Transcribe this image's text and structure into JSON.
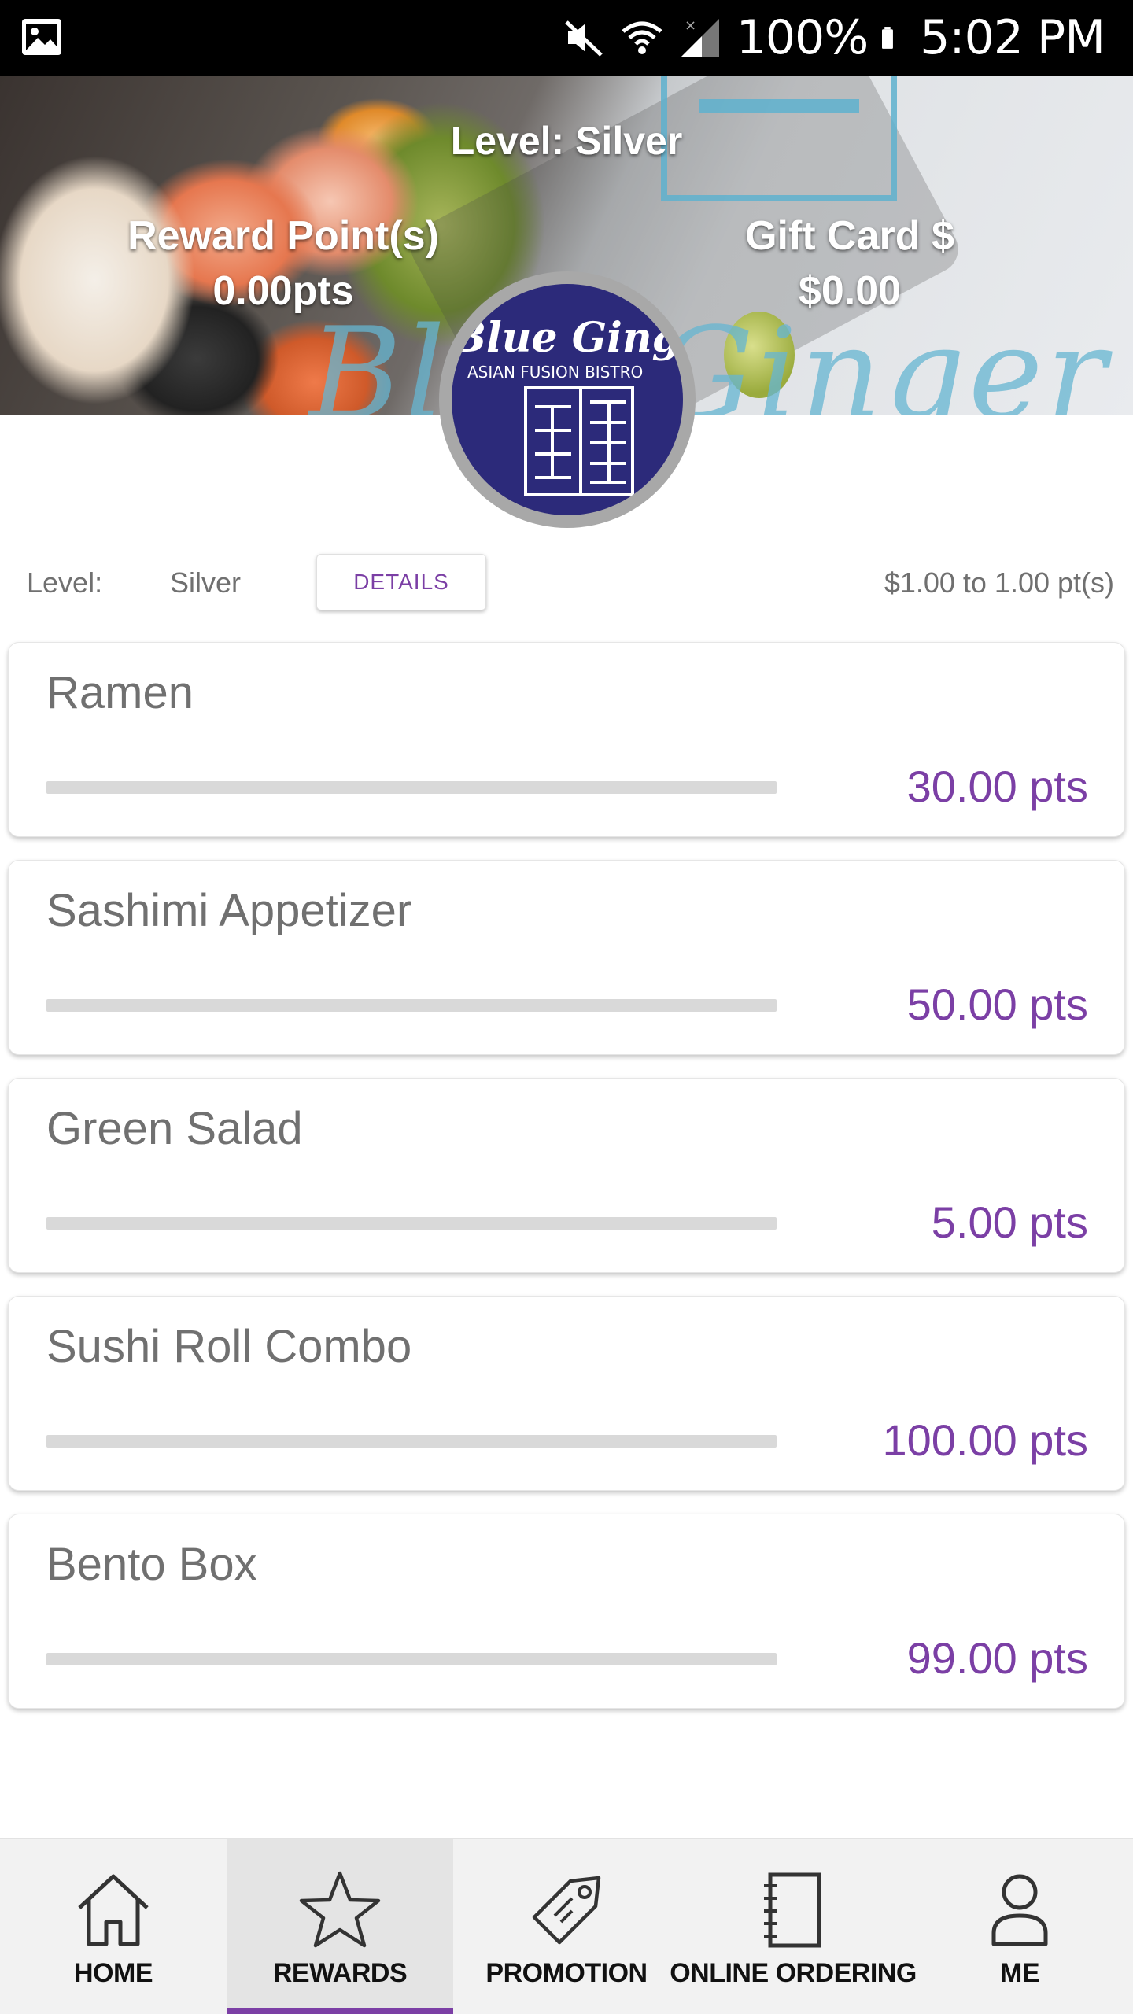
{
  "status_bar": {
    "battery": "100%",
    "time": "5:02 PM",
    "icons": [
      "image-icon",
      "mute-icon",
      "wifi-icon",
      "signal-icon",
      "battery-icon"
    ]
  },
  "header": {
    "level_text": "Level: Silver",
    "reward_points_label": "Reward Point(s)",
    "reward_points_value": "0.00pts",
    "gift_card_label": "Gift Card $",
    "gift_card_value": "$0.00",
    "logo_text": "Blue Ginger",
    "logo_subtext": "ASIAN FUSION BISTRO"
  },
  "level_row": {
    "label": "Level:",
    "value": "Silver",
    "details_label": "DETAILS",
    "rate": "$1.00 to 1.00 pt(s)"
  },
  "rewards": [
    {
      "name": "Ramen",
      "points": "30.00 pts",
      "progress": 0
    },
    {
      "name": "Sashimi Appetizer",
      "points": "50.00 pts",
      "progress": 0
    },
    {
      "name": "Green Salad",
      "points": "5.00 pts",
      "progress": 0
    },
    {
      "name": "Sushi Roll Combo",
      "points": "100.00 pts",
      "progress": 0
    },
    {
      "name": "Bento Box",
      "points": "99.00 pts",
      "progress": 0
    }
  ],
  "bottom_nav": [
    {
      "label": "HOME",
      "icon": "home-icon",
      "active": false
    },
    {
      "label": "REWARDS",
      "icon": "star-icon",
      "active": true
    },
    {
      "label": "PROMOTION",
      "icon": "tag-icon",
      "active": false
    },
    {
      "label": "ONLINE ORDERING",
      "icon": "notebook-icon",
      "active": false
    },
    {
      "label": "ME",
      "icon": "person-icon",
      "active": false
    }
  ],
  "colors": {
    "accent": "#7b3fa5",
    "logo_blue": "#2c2a7a",
    "text_gray": "#707070"
  }
}
